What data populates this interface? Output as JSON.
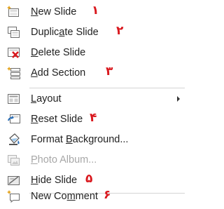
{
  "menu": {
    "items": [
      {
        "icon": "new-slide-icon",
        "pre": "",
        "acc": "N",
        "post": "ew Slide",
        "number": "۱",
        "disabled": false
      },
      {
        "icon": "duplicate-slide-icon",
        "pre": "Duplic",
        "acc": "a",
        "post": "te Slide",
        "number": "۲",
        "disabled": false
      },
      {
        "icon": "delete-slide-icon",
        "pre": "",
        "acc": "D",
        "post": "elete Slide",
        "number": "",
        "disabled": false
      },
      {
        "icon": "add-section-icon",
        "pre": "",
        "acc": "A",
        "post": "dd Section",
        "number": "۳",
        "disabled": false
      },
      {
        "icon": "layout-icon",
        "pre": "",
        "acc": "L",
        "post": "ayout",
        "number": "",
        "disabled": false,
        "submenu": true
      },
      {
        "icon": "reset-slide-icon",
        "pre": "",
        "acc": "R",
        "post": "eset Slide",
        "number": "۴",
        "disabled": false
      },
      {
        "icon": "format-background-icon",
        "pre": "Format ",
        "acc": "B",
        "post": "ackground...",
        "number": "",
        "disabled": false
      },
      {
        "icon": "photo-album-icon",
        "pre": "",
        "acc": "P",
        "post": "hoto Album...",
        "number": "",
        "disabled": true
      },
      {
        "icon": "hide-slide-icon",
        "pre": "",
        "acc": "H",
        "post": "ide Slide",
        "number": "۵",
        "disabled": false
      },
      {
        "icon": "new-comment-icon",
        "pre": "New Co",
        "acc": "m",
        "post": "ment",
        "number": "۶",
        "disabled": false
      }
    ]
  },
  "colors": {
    "annotation_red": "#d9181e",
    "text": "#222222",
    "disabled_text": "#a7a7a7",
    "separator": "#d4d4d4"
  }
}
